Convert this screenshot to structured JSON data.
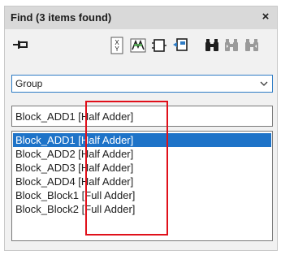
{
  "window": {
    "title": "Find (3 items found)",
    "close_glyph": "×"
  },
  "toolbar": {
    "buttons": [
      {
        "name": "pin-icon"
      },
      {
        "name": "match-case-icon"
      },
      {
        "name": "filter-icon"
      },
      {
        "name": "block-icon"
      },
      {
        "name": "port-icon"
      },
      {
        "name": "find-icon"
      },
      {
        "name": "find-prev-icon"
      },
      {
        "name": "find-next-icon"
      }
    ]
  },
  "scope_combo": {
    "value": "Group"
  },
  "search": {
    "value": "Block_ADD1 [Half Adder]"
  },
  "results": [
    {
      "label": "Block_ADD1 [Half Adder]",
      "selected": true
    },
    {
      "label": "Block_ADD2 [Half Adder]",
      "selected": false
    },
    {
      "label": "Block_ADD3 [Half Adder]",
      "selected": false
    },
    {
      "label": "Block_ADD4 [Half Adder]",
      "selected": false
    },
    {
      "label": "Block_Block1 [Full Adder]",
      "selected": false
    },
    {
      "label": "Block_Block2 [Full Adder]",
      "selected": false
    }
  ],
  "colors": {
    "accent": "#1e73c8",
    "highlight": "#e0101a"
  }
}
